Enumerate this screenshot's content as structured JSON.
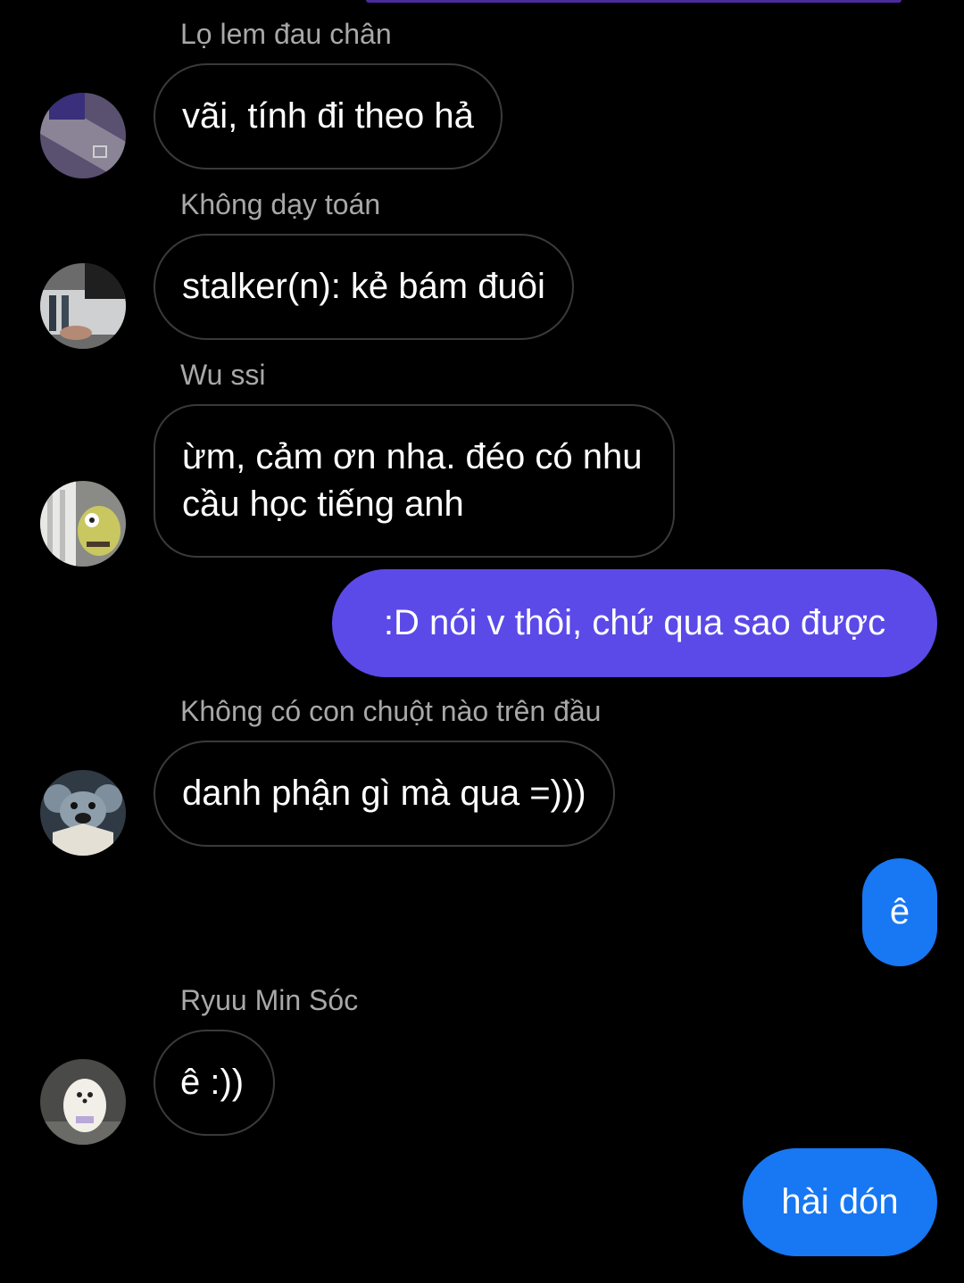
{
  "colors": {
    "background": "#000000",
    "incoming_border": "#3a3a3c",
    "sender_name": "#a8a8a8",
    "outgoing_purple": "#5b4ae8",
    "outgoing_blue": "#1877f2"
  },
  "messages": [
    {
      "direction": "in",
      "sender": "Lọ lem đau chân",
      "text": "vãi, tính đi theo hả",
      "avatar_icon": "dance-mat-avatar-icon"
    },
    {
      "direction": "in",
      "sender": "Không dạy toán",
      "text": "stalker(n): kẻ bám đuôi",
      "avatar_icon": "records-avatar-icon"
    },
    {
      "direction": "in",
      "sender": "Wu ssi",
      "text": "ừm, cảm ơn nha. đéo có nhu cầu học tiếng anh",
      "avatar_icon": "plush-toy-avatar-icon"
    },
    {
      "direction": "out",
      "text": ":D nói v thôi, chứ qua sao được"
    },
    {
      "direction": "in",
      "sender": "Không có con chuột nào trên đầu",
      "text": "danh phận gì mà qua =)))",
      "avatar_icon": "mouse-avatar-icon"
    },
    {
      "direction": "out",
      "text": "ê"
    },
    {
      "direction": "in",
      "sender": "Ryuu Min Sóc",
      "text": "ê :))",
      "avatar_icon": "puppy-avatar-icon"
    },
    {
      "direction": "out",
      "text": "hài dón"
    }
  ]
}
